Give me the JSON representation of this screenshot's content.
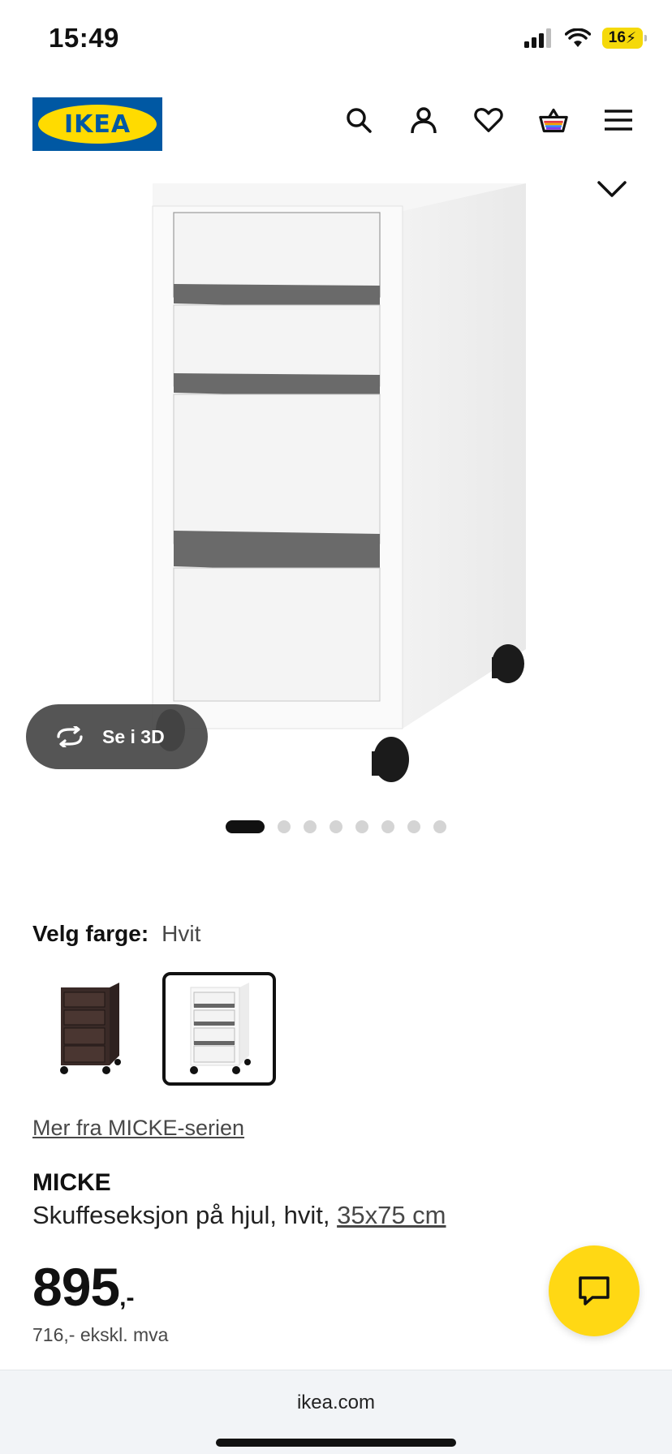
{
  "status_bar": {
    "time": "15:49",
    "battery": "16",
    "icons": [
      "signal-icon",
      "wifi-icon",
      "battery-charging-icon"
    ]
  },
  "header": {
    "logo_text": "IKEA",
    "icons": [
      "search-icon",
      "account-icon",
      "heart-icon",
      "cart-icon",
      "menu-icon"
    ]
  },
  "gallery": {
    "view_3d_label": "Se i 3D",
    "dot_count": 8,
    "active_dot": 0
  },
  "color_picker": {
    "label": "Velg farge:",
    "selected": "Hvit",
    "options": [
      "dark-brown-variant",
      "white-variant"
    ],
    "selected_index": 1
  },
  "series_link": "Mer fra MICKE-serien",
  "product": {
    "name": "MICKE",
    "description": "Skuffeseksjon på hjul, hvit,",
    "size": "35x75 cm"
  },
  "price": {
    "integer": "895",
    "decimals": ",-",
    "ex_vat": "716,- ekskl. mva"
  },
  "browser": {
    "url": "ikea.com"
  },
  "colors": {
    "brand_blue": "#0058a3",
    "brand_yellow": "#ffdb00",
    "chat_yellow": "#ffd814"
  }
}
